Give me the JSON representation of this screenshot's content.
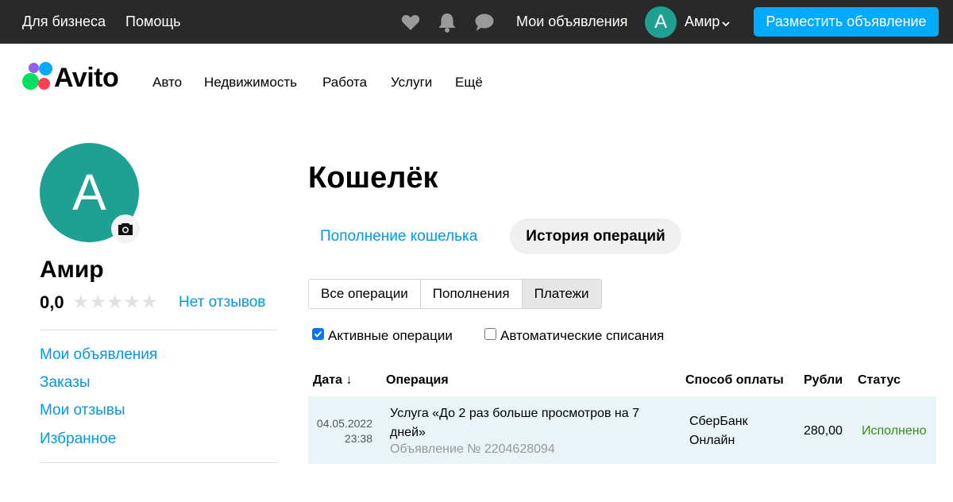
{
  "topbar": {
    "business_link": "Для бизнеса",
    "help_link": "Помощь",
    "icons": [
      "heart-icon",
      "bell-icon",
      "chat-icon"
    ],
    "my_ads_link": "Мои объявления",
    "avatar_letter": "А",
    "user_name": "Амир",
    "post_button": "Разместить объявление"
  },
  "header": {
    "logo_text": "Avito",
    "nav": [
      "Авто",
      "Недвижимость",
      "Работа",
      "Услуги",
      "Ещё"
    ]
  },
  "profile": {
    "avatar_letter": "А",
    "name": "Амир",
    "rating": "0,0",
    "stars_filled": 0,
    "stars_total": 5,
    "reviews_link": "Нет отзывов",
    "menu": [
      "Мои объявления",
      "Заказы",
      "Мои отзывы",
      "Избранное"
    ]
  },
  "wallet": {
    "title": "Кошелёк",
    "tabs": {
      "topup": "Пополнение кошелька",
      "history": "История операций"
    },
    "filters": [
      {
        "label": "Все операции",
        "selected": false
      },
      {
        "label": "Пополнения",
        "selected": false
      },
      {
        "label": "Платежи",
        "selected": true
      }
    ],
    "checkboxes": [
      {
        "label": "Активные операции",
        "checked": true
      },
      {
        "label": "Автоматические списания",
        "checked": false
      }
    ],
    "columns": [
      "Дата ↓",
      "Операция",
      "Способ оплаты",
      "Рубли",
      "Статус"
    ],
    "rows": [
      {
        "date": "04.05.2022",
        "time": "23:38",
        "operation": "Услуга «До 2 раз больше просмотров на 7 дней»",
        "ad_ref": "Объявление № 2204628094",
        "payment": "СберБанк Онлайн",
        "amount": "280,00",
        "status": "Исполнено"
      }
    ]
  },
  "colors": {
    "topbar_bg": "#292929",
    "accent_blue": "#00aaff",
    "link_blue": "#0099ea",
    "avatar_teal": "#1ea093",
    "status_green": "#3a8a1c",
    "row_highlight": "#e8f4f8"
  }
}
